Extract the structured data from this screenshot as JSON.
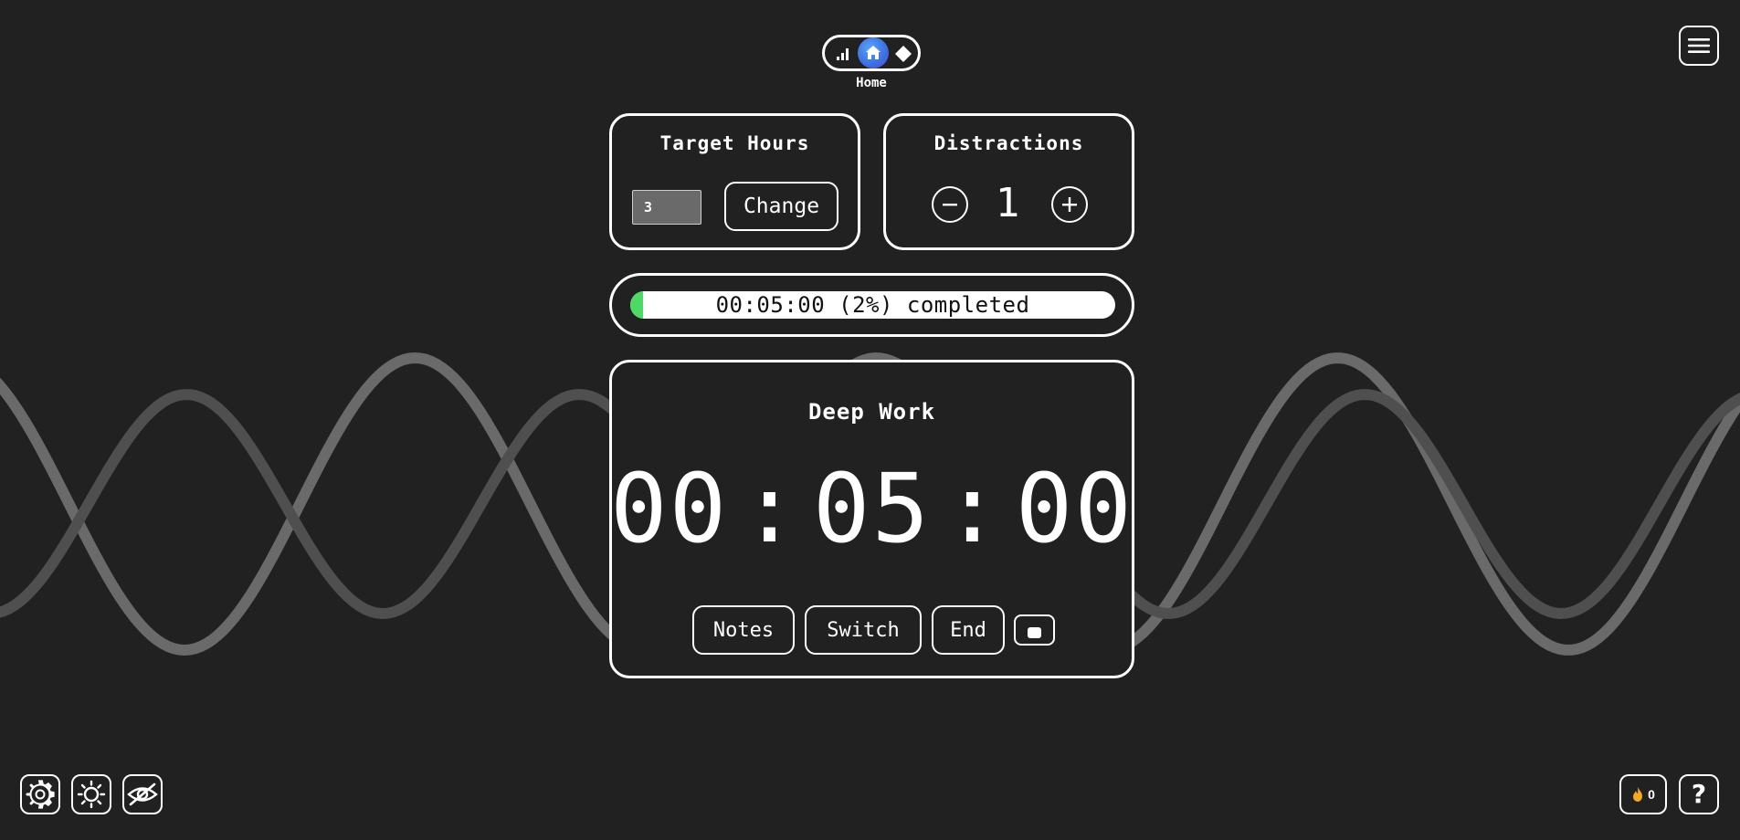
{
  "nav": {
    "current_page": "Home",
    "items": [
      "stats-icon",
      "home-icon",
      "diamond-icon"
    ],
    "menu_icon": "hamburger-menu-icon"
  },
  "target_hours": {
    "title": "Target Hours",
    "value": "3",
    "change_label": "Change"
  },
  "distractions": {
    "title": "Distractions",
    "count": "1",
    "minus_icon": "minus-icon",
    "plus_icon": "plus-icon"
  },
  "progress": {
    "label": "00:05:00 (2%) completed",
    "percent": 2,
    "fill_color": "#4cd964"
  },
  "timer": {
    "mode": "Deep Work",
    "hours": "00",
    "minutes": "05",
    "seconds": "00",
    "separator": ":",
    "notes_label": "Notes",
    "switch_label": "Switch",
    "end_label": "End"
  },
  "footer": {
    "left_icons": [
      "gear-icon",
      "sun-icon",
      "eye-off-icon"
    ],
    "streak_count": "0",
    "streak_icon": "flame-icon",
    "help_label": "?"
  },
  "colors": {
    "background": "#212121",
    "foreground": "#ffffff",
    "accent_blue": "#4a90e2",
    "flame": "#f5a623"
  }
}
